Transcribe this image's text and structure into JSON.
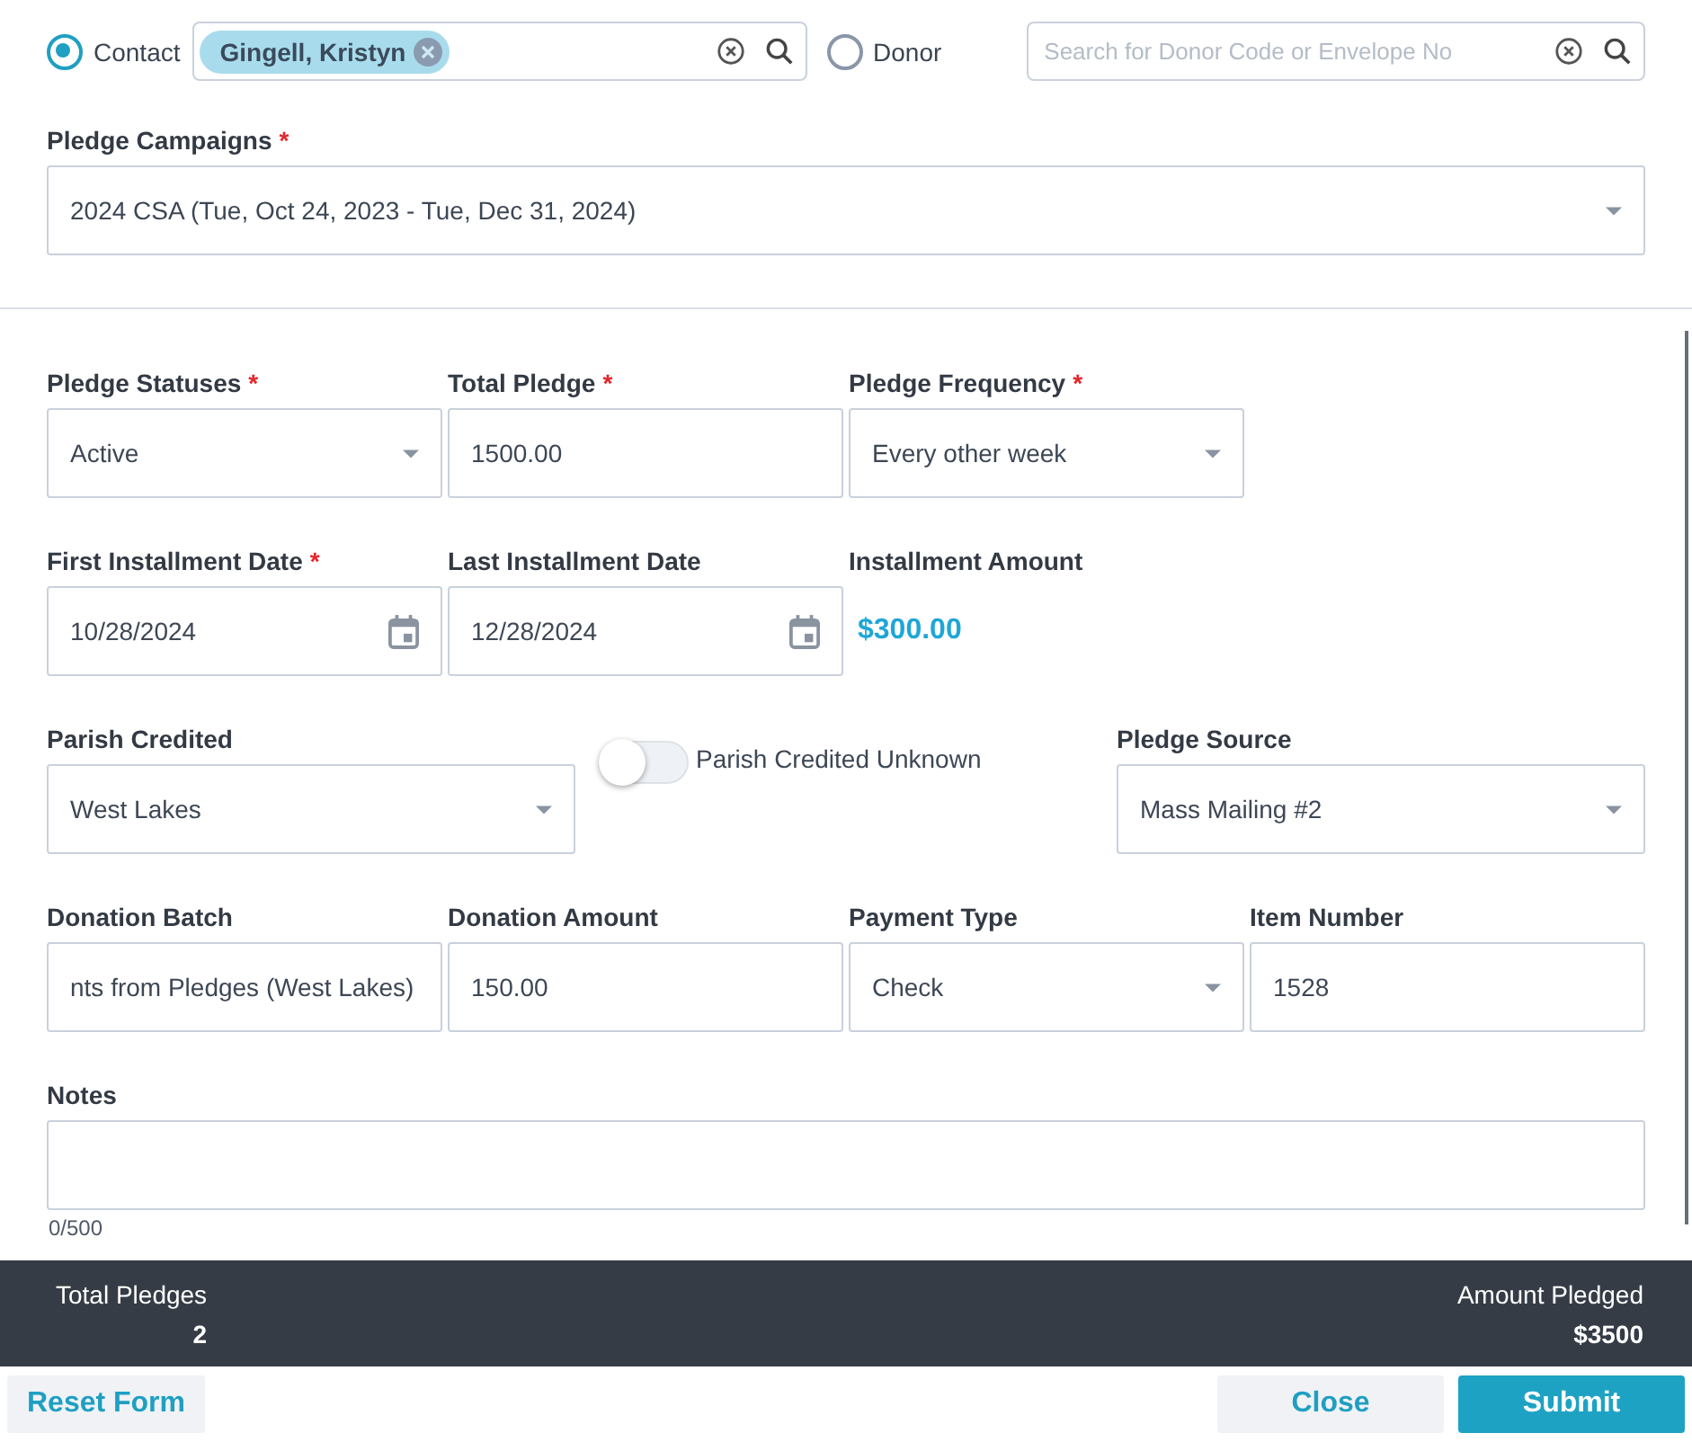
{
  "lookup": {
    "contact": {
      "label": "Contact",
      "selected": true,
      "chip": "Gingell, Kristyn"
    },
    "donor": {
      "label": "Donor",
      "selected": false,
      "placeholder": "Search for Donor Code or Envelope No"
    }
  },
  "campaign": {
    "label": "Pledge Campaigns",
    "required_mark": "*",
    "value": "2024 CSA (Tue, Oct 24, 2023 - Tue, Dec 31, 2024)"
  },
  "rows": [
    {
      "fields": [
        {
          "kind": "select",
          "label": "Pledge Statuses",
          "required_mark": "*",
          "value": "Active"
        },
        {
          "kind": "text",
          "label": "Total Pledge",
          "required_mark": "*",
          "value": "1500.00"
        },
        {
          "kind": "select",
          "label": "Pledge Frequency",
          "required_mark": "*",
          "value": "Every other week"
        }
      ]
    },
    {
      "fields": [
        {
          "kind": "date",
          "label": "First Installment Date",
          "required_mark": "*",
          "value": "10/28/2024"
        },
        {
          "kind": "date",
          "label": "Last Installment Date",
          "value": "12/28/2024"
        },
        {
          "kind": "amount",
          "label": "Installment Amount",
          "value": "$300.00"
        }
      ]
    },
    {
      "fields": [
        {
          "kind": "select",
          "label": "Parish Credited",
          "value": "West Lakes"
        },
        {
          "kind": "toggle",
          "label": "Parish Credited Unknown",
          "on": false
        },
        {
          "kind": "select",
          "label": "Pledge Source",
          "value": "Mass Mailing #2"
        }
      ]
    },
    {
      "fields": [
        {
          "kind": "text",
          "label": "Donation Batch",
          "value": "nts from Pledges (West Lakes)"
        },
        {
          "kind": "text",
          "label": "Donation Amount",
          "value": "150.00"
        },
        {
          "kind": "select",
          "label": "Payment Type",
          "value": "Check"
        },
        {
          "kind": "text",
          "label": "Item Number",
          "value": "1528"
        }
      ]
    }
  ],
  "notes": {
    "label": "Notes",
    "counter": "0/500"
  },
  "summary": {
    "total_label": "Total Pledges",
    "total_value": "2",
    "amount_label": "Amount Pledged",
    "amount_value": "$3500"
  },
  "buttons": {
    "reset": "Reset Form",
    "close": "Close",
    "submit": "Submit"
  }
}
